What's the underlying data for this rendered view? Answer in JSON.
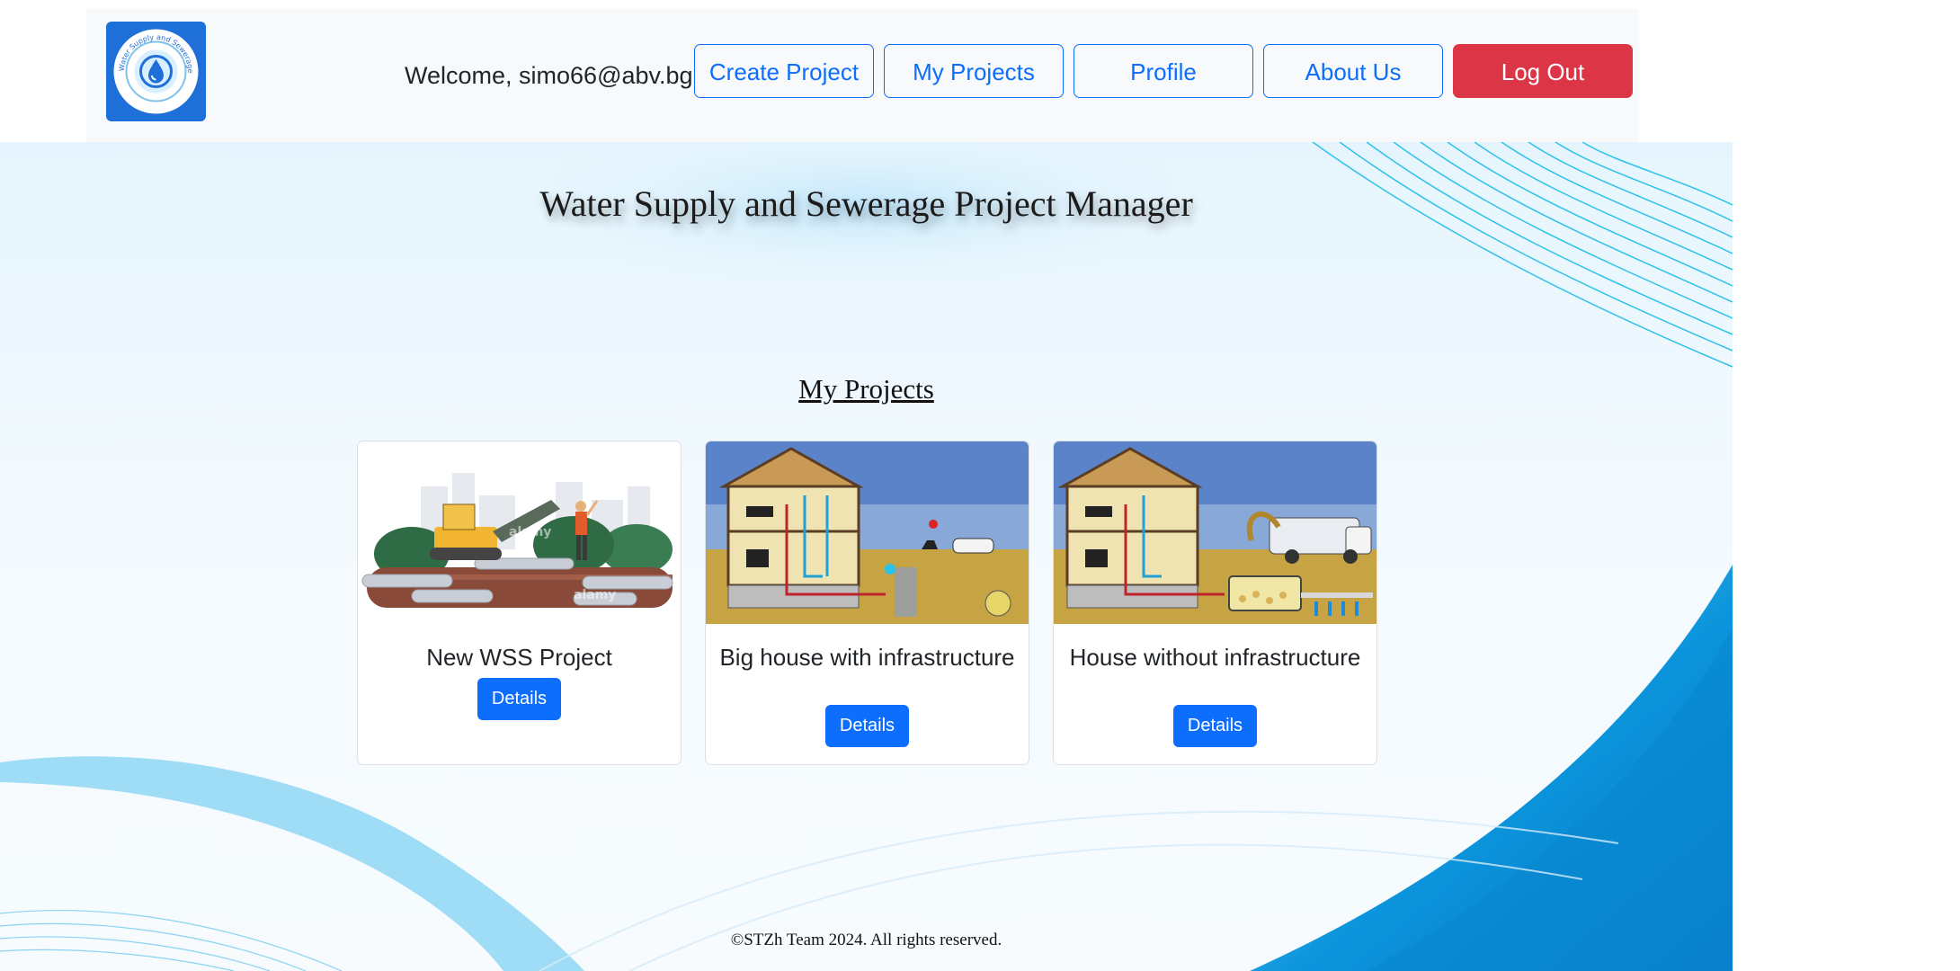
{
  "colors": {
    "primary": "#0d6efd",
    "danger": "#dc3545",
    "logo_bg": "#1f6fd9",
    "wave_blue": "#0b8fd6"
  },
  "header": {
    "logo_icon": "water-drop-logo-icon",
    "logo_text": "Water Supply and Sewerage Project Manager",
    "welcome": "Welcome, simo66@abv.bg",
    "nav": {
      "create_project": "Create Project",
      "my_projects": "My Projects",
      "profile": "Profile",
      "about_us": "About Us",
      "log_out": "Log Out"
    }
  },
  "main": {
    "title": "Water Supply and Sewerage Project Manager",
    "section_title": "My Projects",
    "projects": [
      {
        "title": "New WSS Project",
        "image_icon": "construction-excavator-image",
        "details_label": "Details"
      },
      {
        "title": "Big house with infrastructure",
        "image_icon": "house-plumbing-diagram-image",
        "details_label": "Details"
      },
      {
        "title": "House without infrastructure",
        "image_icon": "house-septic-diagram-image",
        "details_label": "Details"
      }
    ]
  },
  "footer": {
    "copyright": "©STZh Team 2024. All rights reserved."
  }
}
